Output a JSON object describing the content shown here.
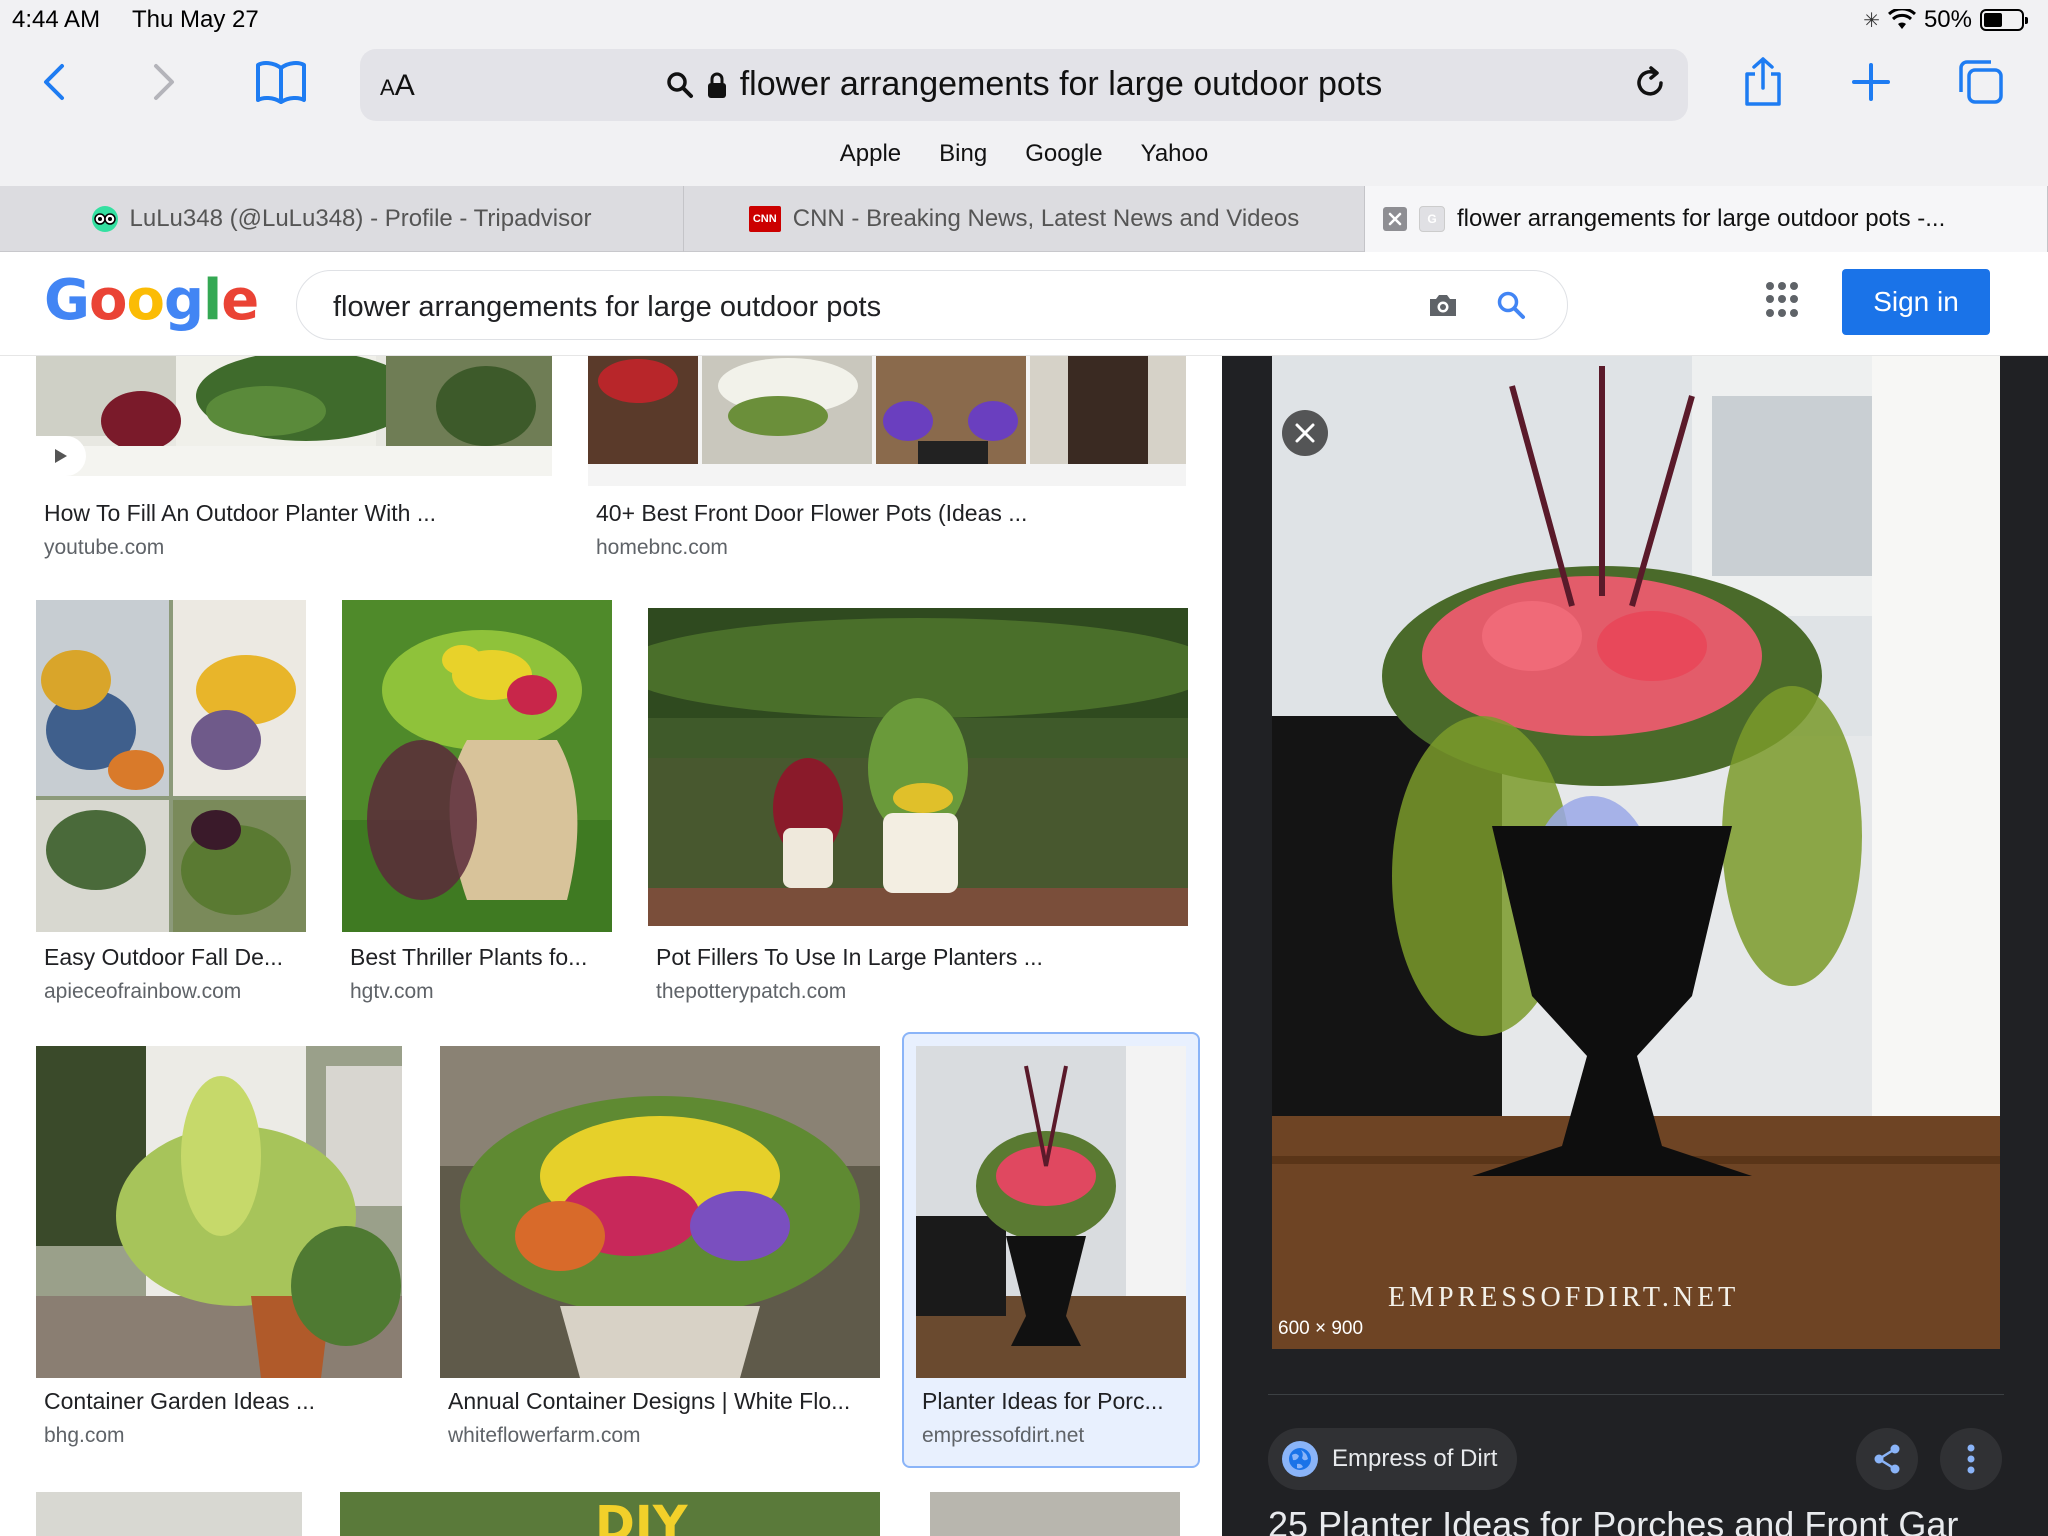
{
  "status": {
    "time": "4:44 AM",
    "date": "Thu May 27",
    "battery": "50%",
    "battery_level": 0.5
  },
  "browser": {
    "aa_label_small": "A",
    "aa_label_large": "A",
    "url_text": "flower arrangements for large outdoor pots",
    "favorites": [
      "Apple",
      "Bing",
      "Google",
      "Yahoo"
    ],
    "tabs": [
      {
        "title": "LuLu348 (@LuLu348) - Profile - Tripadvisor",
        "favicon": "tripadvisor-owl-icon"
      },
      {
        "title": "CNN - Breaking News, Latest News and Videos",
        "favicon": "cnn-logo-icon",
        "favicon_text": "CNN"
      },
      {
        "title": "flower arrangements for large outdoor pots -...",
        "favicon": "google-g-icon",
        "favicon_text": "G"
      }
    ]
  },
  "google": {
    "logo_letters": [
      "G",
      "o",
      "o",
      "g",
      "l",
      "e"
    ],
    "logo_colors": [
      "#4285f4",
      "#ea4335",
      "#fbbc05",
      "#4285f4",
      "#34a853",
      "#ea4335"
    ],
    "search_value": "flower arrangements for large outdoor pots",
    "signin_label": "Sign in"
  },
  "results": [
    {
      "title": "How To Fill An Outdoor Planter With ...",
      "source": "youtube.com"
    },
    {
      "title": "40+ Best Front Door Flower Pots (Ideas ...",
      "source": "homebnc.com"
    },
    {
      "title": "Easy Outdoor Fall De...",
      "source": "apieceofrainbow.com"
    },
    {
      "title": "Best Thriller Plants fo...",
      "source": "hgtv.com"
    },
    {
      "title": "Pot Fillers To Use In Large Planters ...",
      "source": "thepotterypatch.com"
    },
    {
      "title": "Container Garden Ideas ...",
      "source": "bhg.com"
    },
    {
      "title": "Annual Container Designs | White Flo...",
      "source": "whiteflowerfarm.com"
    },
    {
      "title": "Planter Ideas for Porc...",
      "source": "empressofdirt.net"
    }
  ],
  "partial_results": {
    "diy_text": "DIY"
  },
  "preview": {
    "dimensions": "600 × 900",
    "watermark": "EMPRESSOFDIRT.NET",
    "site_name": "Empress of Dirt",
    "title_partial": "25 Planter Ideas for Porches and Front Gar"
  },
  "colors": {
    "accent_blue": "#1a73e8",
    "ios_blue": "#1e7cf2",
    "preview_bg": "#202124"
  }
}
